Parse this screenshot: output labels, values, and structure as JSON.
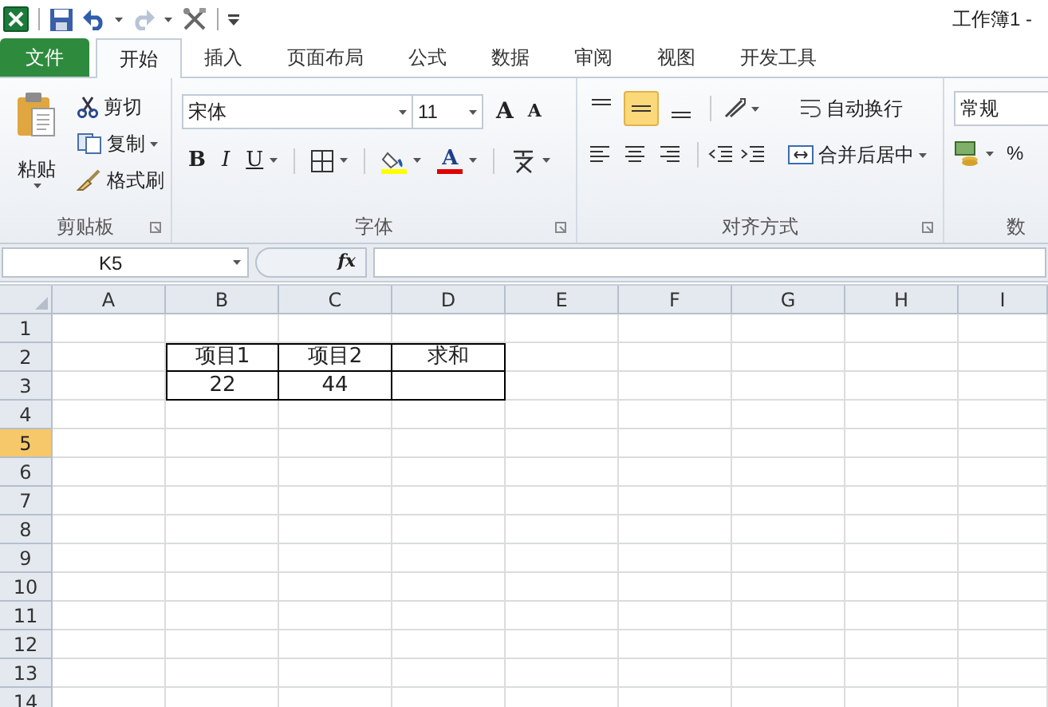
{
  "title_bar": {
    "title": "工作簿1 -"
  },
  "tabs": [
    {
      "label": "文件",
      "kind": "file",
      "selected": false
    },
    {
      "label": "开始",
      "kind": "tab",
      "selected": true
    },
    {
      "label": "插入",
      "kind": "tab",
      "selected": false
    },
    {
      "label": "页面布局",
      "kind": "tab",
      "selected": false
    },
    {
      "label": "公式",
      "kind": "tab",
      "selected": false
    },
    {
      "label": "数据",
      "kind": "tab",
      "selected": false
    },
    {
      "label": "审阅",
      "kind": "tab",
      "selected": false
    },
    {
      "label": "视图",
      "kind": "tab",
      "selected": false
    },
    {
      "label": "开发工具",
      "kind": "tab",
      "selected": false
    }
  ],
  "clipboard": {
    "paste": "粘贴",
    "cut": "剪切",
    "copy": "复制",
    "format_painter": "格式刷",
    "label": "剪贴板"
  },
  "font": {
    "name": "宋体",
    "size": "11",
    "grow": "A",
    "shrink": "A",
    "bold": "B",
    "italic": "I",
    "underline": "U",
    "font_color": "A",
    "label": "字体"
  },
  "alignment": {
    "buttons": [
      {
        "kind": "top",
        "selected": false
      },
      {
        "kind": "middle",
        "selected": true
      },
      {
        "kind": "bottom",
        "selected": false
      }
    ],
    "wrap": "自动换行",
    "merge": "合并后居中",
    "label": "对齐方式"
  },
  "number": {
    "format": "常规",
    "percent": "%",
    "label": "数"
  },
  "formula_bar": {
    "name_box": "K5",
    "fx": "fx"
  },
  "sheet": {
    "columns": [
      "A",
      "B",
      "C",
      "D",
      "E",
      "F",
      "G",
      "H",
      "I"
    ],
    "rows": [
      {
        "header": "1",
        "selected": false
      },
      {
        "header": "2",
        "selected": false
      },
      {
        "header": "3",
        "selected": false
      },
      {
        "header": "4",
        "selected": false
      },
      {
        "header": "5",
        "selected": true
      },
      {
        "header": "6",
        "selected": false
      },
      {
        "header": "7",
        "selected": false
      },
      {
        "header": "8",
        "selected": false
      },
      {
        "header": "9",
        "selected": false
      },
      {
        "header": "10",
        "selected": false
      },
      {
        "header": "11",
        "selected": false
      },
      {
        "header": "12",
        "selected": false
      },
      {
        "header": "13",
        "selected": false
      },
      {
        "header": "14",
        "selected": false
      }
    ],
    "table": {
      "columns": [
        "项目1",
        "项目2",
        "求和"
      ],
      "rows": [
        [
          "22",
          "44"
        ]
      ]
    }
  }
}
